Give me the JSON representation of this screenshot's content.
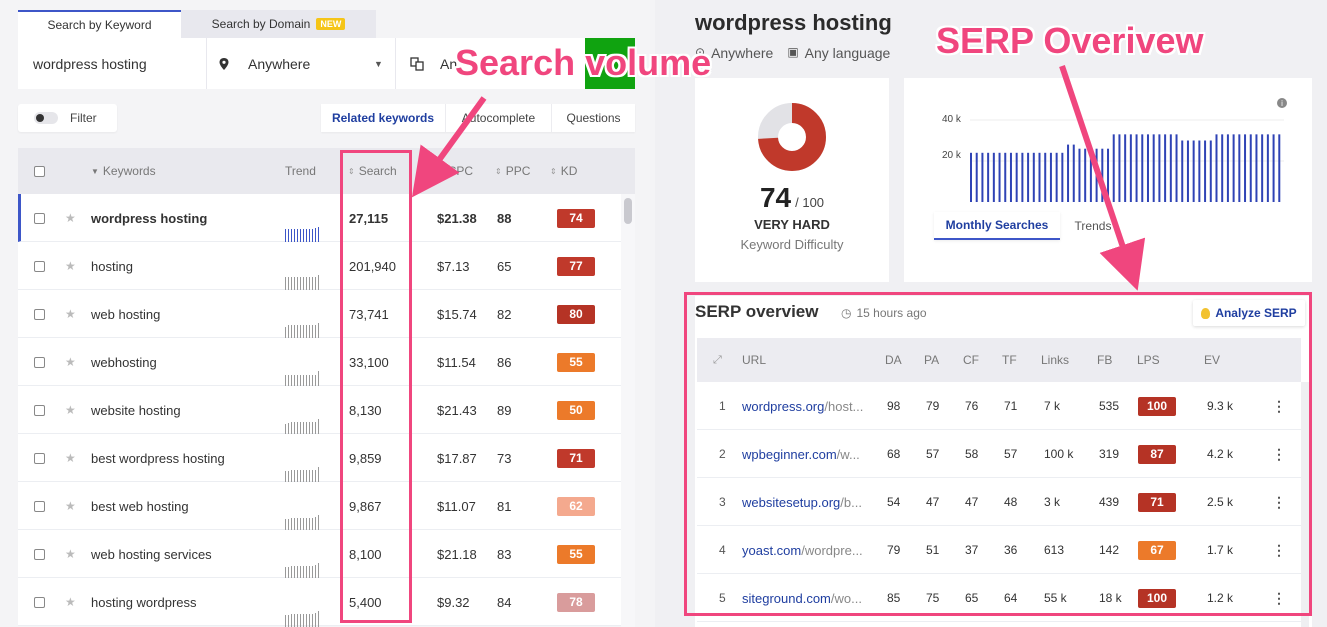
{
  "tabs": {
    "keyword": "Search by Keyword",
    "domain": "Search by Domain",
    "new_badge": "NEW"
  },
  "search": {
    "query": "wordpress hosting",
    "location": "Anywhere",
    "language_partial": "An"
  },
  "filter": {
    "label": "Filter"
  },
  "subtabs": [
    "Related keywords",
    "Autocomplete",
    "Questions"
  ],
  "table_headers": {
    "keywords": "Keywords",
    "trend": "Trend",
    "search": "Search",
    "cpc": "CPC",
    "ppc": "PPC",
    "kd": "KD"
  },
  "rows": [
    {
      "kw": "wordpress hosting",
      "search": "27,115",
      "cpc": "$21.38",
      "ppc": "88",
      "kd": "74",
      "kd_color": "#c0392b",
      "trend": [
        14,
        14,
        14,
        14,
        14,
        14,
        14,
        14,
        14,
        14,
        15,
        16
      ]
    },
    {
      "kw": "hosting",
      "search": "201,940",
      "cpc": "$7.13",
      "ppc": "65",
      "kd": "77",
      "kd_color": "#c0392b",
      "trend": [
        14,
        14,
        14,
        14,
        14,
        14,
        14,
        14,
        14,
        14,
        14,
        16
      ]
    },
    {
      "kw": "web hosting",
      "search": "73,741",
      "cpc": "$15.74",
      "ppc": "82",
      "kd": "80",
      "kd_color": "#b53325",
      "trend": [
        12,
        14,
        14,
        14,
        14,
        14,
        14,
        14,
        14,
        14,
        14,
        16
      ]
    },
    {
      "kw": "webhosting",
      "search": "33,100",
      "cpc": "$11.54",
      "ppc": "86",
      "kd": "55",
      "kd_color": "#ec7a2a",
      "trend": [
        12,
        12,
        12,
        12,
        12,
        12,
        12,
        12,
        12,
        12,
        12,
        16
      ]
    },
    {
      "kw": "website hosting",
      "search": "8,130",
      "cpc": "$21.43",
      "ppc": "89",
      "kd": "50",
      "kd_color": "#ec7a2a",
      "trend": [
        11,
        12,
        13,
        13,
        13,
        13,
        13,
        13,
        13,
        13,
        13,
        16
      ]
    },
    {
      "kw": "best wordpress hosting",
      "search": "9,859",
      "cpc": "$17.87",
      "ppc": "73",
      "kd": "71",
      "kd_color": "#c0392b",
      "trend": [
        12,
        12,
        13,
        13,
        13,
        13,
        13,
        13,
        13,
        13,
        13,
        16
      ]
    },
    {
      "kw": "best web hosting",
      "search": "9,867",
      "cpc": "$11.07",
      "ppc": "81",
      "kd": "62",
      "kd_color": "#f4a98e",
      "trend": [
        12,
        12,
        13,
        13,
        13,
        13,
        13,
        13,
        13,
        13,
        14,
        16
      ]
    },
    {
      "kw": "web hosting services",
      "search": "8,100",
      "cpc": "$21.18",
      "ppc": "83",
      "kd": "55",
      "kd_color": "#ec7a2a",
      "trend": [
        12,
        12,
        13,
        13,
        13,
        13,
        13,
        13,
        13,
        13,
        14,
        16
      ]
    },
    {
      "kw": "hosting wordpress",
      "search": "5,400",
      "cpc": "$9.32",
      "ppc": "84",
      "kd": "78",
      "kd_color": "#d99c9c",
      "trend": [
        12,
        12,
        13,
        13,
        13,
        13,
        13,
        13,
        13,
        13,
        14,
        16
      ]
    }
  ],
  "right": {
    "title": "wordpress hosting",
    "location": "Anywhere",
    "language": "Any language",
    "kd_value": "74",
    "kd_max": "/ 100",
    "kd_level": "VERY HARD",
    "kd_label": "Keyword Difficulty",
    "kd_color": "#c0392b",
    "chart_tabs": [
      "Monthly Searches",
      "Trends"
    ],
    "chart_y_labels": [
      "40 k",
      "20 k"
    ]
  },
  "chart_data": {
    "type": "bar",
    "values": [
      24,
      24,
      24,
      24,
      24,
      24,
      24,
      24,
      24,
      24,
      24,
      24,
      24,
      24,
      24,
      24,
      24,
      28,
      28,
      26,
      26,
      26,
      26,
      26,
      26,
      33,
      33,
      33,
      33,
      33,
      33,
      33,
      33,
      33,
      33,
      33,
      33,
      30,
      30,
      30,
      30,
      30,
      30,
      33,
      33,
      33,
      33,
      33,
      33,
      33,
      33,
      33,
      33,
      33,
      33
    ],
    "ylim": [
      0,
      40
    ]
  },
  "serp": {
    "title": "SERP overview",
    "time": "15 hours ago",
    "analyze": "Analyze SERP",
    "headers": [
      "URL",
      "DA",
      "PA",
      "CF",
      "TF",
      "Links",
      "FB",
      "LPS",
      "EV"
    ],
    "rows": [
      {
        "n": "1",
        "dom": "wordpress.org",
        "path": "/host...",
        "da": "98",
        "pa": "79",
        "cf": "76",
        "tf": "71",
        "links": "7 k",
        "fb": "535",
        "lps": "100",
        "lps_color": "#b53325",
        "ev": "9.3 k"
      },
      {
        "n": "2",
        "dom": "wpbeginner.com",
        "path": "/w...",
        "da": "68",
        "pa": "57",
        "cf": "58",
        "tf": "57",
        "links": "100 k",
        "fb": "319",
        "lps": "87",
        "lps_color": "#b53325",
        "ev": "4.2 k"
      },
      {
        "n": "3",
        "dom": "websitesetup.org",
        "path": "/b...",
        "da": "54",
        "pa": "47",
        "cf": "47",
        "tf": "48",
        "links": "3 k",
        "fb": "439",
        "lps": "71",
        "lps_color": "#b53325",
        "ev": "2.5 k"
      },
      {
        "n": "4",
        "dom": "yoast.com",
        "path": "/wordpre...",
        "da": "79",
        "pa": "51",
        "cf": "37",
        "tf": "36",
        "links": "613",
        "fb": "142",
        "lps": "67",
        "lps_color": "#ec7a2a",
        "ev": "1.7 k"
      },
      {
        "n": "5",
        "dom": "siteground.com",
        "path": "/wo...",
        "da": "85",
        "pa": "75",
        "cf": "65",
        "tf": "64",
        "links": "55 k",
        "fb": "18 k",
        "lps": "100",
        "lps_color": "#b53325",
        "ev": "1.2 k"
      }
    ]
  },
  "annotations": {
    "search_volume": "Search volume",
    "serp_overview": "SERP Overivew",
    "color": "#f0467e"
  }
}
